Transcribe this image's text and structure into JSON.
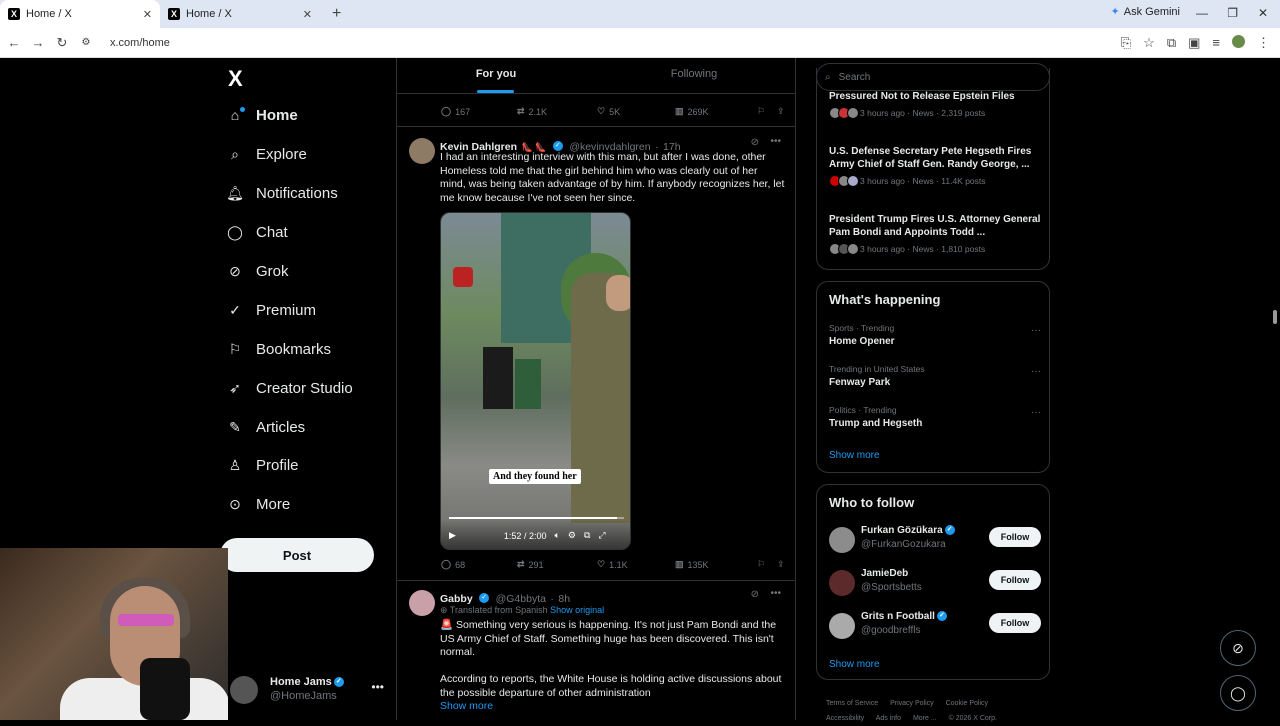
{
  "browser": {
    "tabs": [
      {
        "title": "Home / X"
      },
      {
        "title": "Home / X"
      }
    ],
    "gemini_label": "Ask Gemini",
    "url": "x.com/home"
  },
  "sidebar": {
    "logo": "X",
    "items": [
      {
        "label": "Home",
        "icon": "home-icon"
      },
      {
        "label": "Explore",
        "icon": "search-icon"
      },
      {
        "label": "Notifications",
        "icon": "bell-icon"
      },
      {
        "label": "Chat",
        "icon": "chat-icon"
      },
      {
        "label": "Grok",
        "icon": "grok-icon"
      },
      {
        "label": "Premium",
        "icon": "premium-icon"
      },
      {
        "label": "Bookmarks",
        "icon": "bookmark-icon"
      },
      {
        "label": "Creator Studio",
        "icon": "rocket-icon"
      },
      {
        "label": "Articles",
        "icon": "articles-icon"
      },
      {
        "label": "Profile",
        "icon": "person-icon"
      },
      {
        "label": "More",
        "icon": "more-circle-icon"
      }
    ],
    "post_label": "Post",
    "account": {
      "name": "Home Jams",
      "handle": "@HomeJams"
    }
  },
  "timeline": {
    "tabs": {
      "for_you": "For you",
      "following": "Following"
    },
    "prev_actions": {
      "replies": "167",
      "reposts": "2.1K",
      "likes": "5K",
      "views": "269K"
    },
    "tweet1": {
      "name": "Kevin Dahlgren",
      "emoji": "👠 👠",
      "handle": "@kevinvdahlgren",
      "time": "17h",
      "text": "I had an interesting interview with this man, but after I was done, other Homeless told me that the girl behind him who was clearly out of her mind, was being taken advantage of by him. If anybody recognizes her, let me know because I've not seen her since.",
      "video_caption": "And they found her",
      "video_time": "1:52 / 2:00",
      "video_progress": 0.96,
      "actions": {
        "replies": "68",
        "reposts": "291",
        "likes": "1.1K",
        "views": "135K"
      }
    },
    "tweet2": {
      "name": "Gabby",
      "handle": "@G4bbyta",
      "time": "8h",
      "translated": "Translated from Spanish",
      "show_original": "Show original",
      "line1": "🚨 Something very serious is happening. It's not just Pam Bondi and the US Army Chief of Staff. Something huge has been discovered. This isn't normal.",
      "line2": "According to reports, the White House is holding active discussions about the possible departure of other administration",
      "show_more": "Show more"
    }
  },
  "right": {
    "search_placeholder": "Search",
    "news": [
      {
        "title": "Pressured Not to Release Epstein Files",
        "meta": "3 hours ago · News · 2,319 posts"
      },
      {
        "title": "U.S. Defense Secretary Pete Hegseth Fires Army Chief of Staff Gen. Randy George, ...",
        "meta": "3 hours ago · News · 11.4K posts"
      },
      {
        "title": "President Trump Fires U.S. Attorney General Pam Bondi and Appoints Todd ...",
        "meta": "3 hours ago · News · 1,810 posts"
      }
    ],
    "whats_happening": "What's happening",
    "trends": [
      {
        "context": "Sports · Trending",
        "title": "Home Opener"
      },
      {
        "context": "Trending in United States",
        "title": "Fenway Park"
      },
      {
        "context": "Politics · Trending",
        "title": "Trump and Hegseth"
      }
    ],
    "show_more": "Show more",
    "who_to_follow": "Who to follow",
    "follow_label": "Follow",
    "accounts": [
      {
        "name": "Furkan Gözükara",
        "handle": "@FurkanGozukara",
        "verified": true
      },
      {
        "name": "JamieDeb",
        "handle": "@Sportsbetts",
        "verified": false
      },
      {
        "name": "Grits n Football",
        "handle": "@goodbreffls",
        "verified": true
      }
    ],
    "footer": [
      "Terms of Service",
      "Privacy Policy",
      "Cookie Policy",
      "Accessibility",
      "Ads info",
      "More ...",
      "© 2026 X Corp."
    ]
  }
}
